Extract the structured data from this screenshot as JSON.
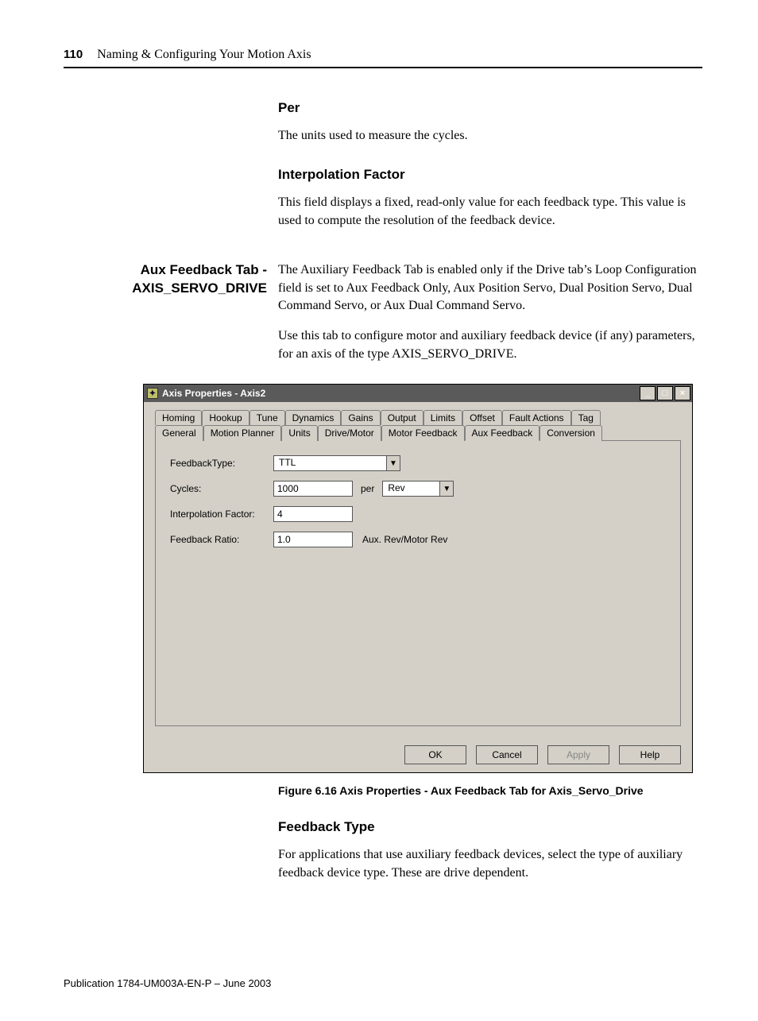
{
  "header": {
    "page_number": "110",
    "chapter": "Naming & Configuring Your Motion Axis"
  },
  "sections": {
    "per_heading": "Per",
    "per_body": "The units used to measure the cycles.",
    "interp_heading": "Interpolation Factor",
    "interp_body": "This field displays a fixed, read-only value for each feedback type. This value is used to compute the resolution of the feedback device.",
    "aux_side_line1": "Aux Feedback Tab -",
    "aux_side_line2": "AXIS_SERVO_DRIVE",
    "aux_body_p1": "The Auxiliary Feedback Tab is enabled only if the Drive tab’s Loop Configuration field is set to Aux Feedback Only, Aux Position Servo, Dual Position Servo, Dual Command Servo, or Aux Dual Command Servo.",
    "aux_body_p2": "Use this tab to configure motor and auxiliary feedback device (if any) parameters, for an axis of the type AXIS_SERVO_DRIVE.",
    "figure_caption": "Figure 6.16 Axis Properties - Aux Feedback Tab for Axis_Servo_Drive",
    "fbtype_heading": "Feedback Type",
    "fbtype_body": "For applications that use auxiliary feedback devices, select the type of auxiliary feedback device type. These are drive dependent."
  },
  "dialog": {
    "title": "Axis Properties - Axis2",
    "tabs_row1": [
      "Homing",
      "Hookup",
      "Tune",
      "Dynamics",
      "Gains",
      "Output",
      "Limits",
      "Offset",
      "Fault Actions",
      "Tag"
    ],
    "tabs_row2": [
      "General",
      "Motion Planner",
      "Units",
      "Drive/Motor",
      "Motor Feedback",
      "Aux Feedback",
      "Conversion"
    ],
    "active_tab": "Aux Feedback",
    "form": {
      "feedback_type_label": "FeedbackType:",
      "feedback_type_value": "TTL",
      "cycles_label": "Cycles:",
      "cycles_value": "1000",
      "per_label": "per",
      "per_unit_value": "Rev",
      "interp_label": "Interpolation Factor:",
      "interp_value": "4",
      "ratio_label": "Feedback Ratio:",
      "ratio_value": "1.0",
      "ratio_unit": "Aux. Rev/Motor Rev"
    },
    "buttons": {
      "ok": "OK",
      "cancel": "Cancel",
      "apply": "Apply",
      "help": "Help"
    }
  },
  "footer": {
    "publication": "Publication 1784-UM003A-EN-P – June 2003"
  }
}
